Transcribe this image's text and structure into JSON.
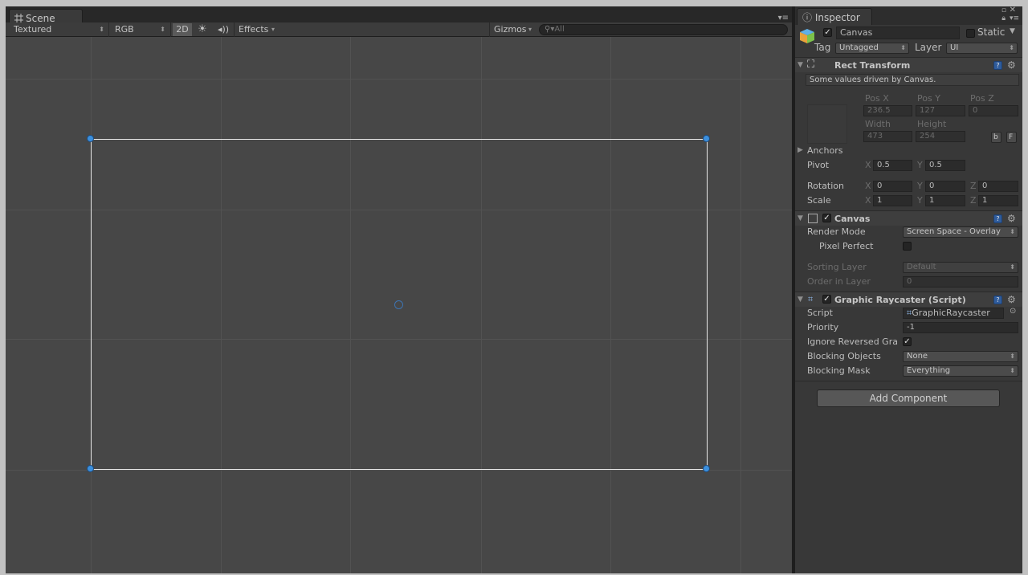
{
  "scene": {
    "tab_label": "Scene",
    "shading_mode": "Textured",
    "render_mode": "RGB",
    "btn_2d": "2D",
    "effects_label": "Effects",
    "gizmos_label": "Gizmos",
    "search_placeholder": "All"
  },
  "inspector": {
    "tab_label": "Inspector",
    "object_name": "Canvas",
    "static_label": "Static",
    "tag_label": "Tag",
    "tag_value": "Untagged",
    "layer_label": "Layer",
    "layer_value": "UI",
    "rect_transform": {
      "title": "Rect Transform",
      "driven_note": "Some values driven by Canvas.",
      "pos_x_label": "Pos X",
      "pos_x": "236.5",
      "pos_y_label": "Pos Y",
      "pos_y": "127",
      "pos_z_label": "Pos Z",
      "pos_z": "0",
      "width_label": "Width",
      "width": "473",
      "height_label": "Height",
      "height": "254",
      "blueprint_btn": "b",
      "raw_btn": "F",
      "anchors_label": "Anchors",
      "pivot_label": "Pivot",
      "pivot_x_label": "X",
      "pivot_x": "0.5",
      "pivot_y_label": "Y",
      "pivot_y": "0.5",
      "rotation_label": "Rotation",
      "rot_x_label": "X",
      "rot_x": "0",
      "rot_y_label": "Y",
      "rot_y": "0",
      "rot_z_label": "Z",
      "rot_z": "0",
      "scale_label": "Scale",
      "scale_x_label": "X",
      "scale_x": "1",
      "scale_y_label": "Y",
      "scale_y": "1",
      "scale_z_label": "Z",
      "scale_z": "1"
    },
    "canvas": {
      "title": "Canvas",
      "render_mode_label": "Render Mode",
      "render_mode_value": "Screen Space - Overlay",
      "pixel_perfect_label": "Pixel Perfect",
      "sorting_layer_label": "Sorting Layer",
      "sorting_layer_value": "Default",
      "order_label": "Order in Layer",
      "order_value": "0"
    },
    "raycaster": {
      "title": "Graphic Raycaster (Script)",
      "script_label": "Script",
      "script_value": "GraphicRaycaster",
      "priority_label": "Priority",
      "priority_value": "-1",
      "ignore_label": "Ignore Reversed Gra",
      "blocking_objects_label": "Blocking Objects",
      "blocking_objects_value": "None",
      "blocking_mask_label": "Blocking Mask",
      "blocking_mask_value": "Everything"
    },
    "add_component_label": "Add Component"
  },
  "colors": {
    "viewport_bg": "#474747",
    "canvas_outline": "#e8e8e8",
    "handle_blue": "#3c8fdc",
    "panel_bg": "#383838"
  }
}
